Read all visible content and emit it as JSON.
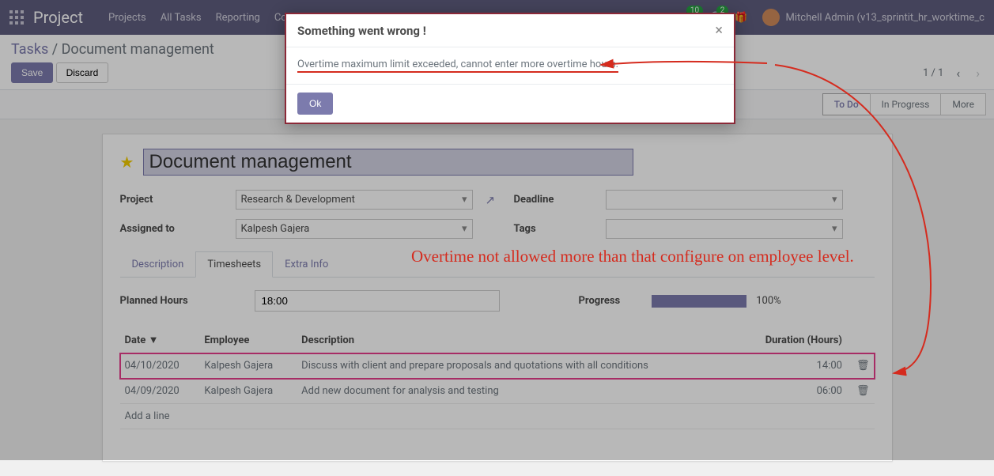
{
  "navbar": {
    "brand": "Project",
    "items": [
      "Projects",
      "All Tasks",
      "Reporting",
      "Configuration"
    ],
    "msg_badge": "10",
    "activity_badge": "2",
    "user_name": "Mitchell Admin (v13_sprintit_hr_worktime_c"
  },
  "breadcrumb": {
    "parent": "Tasks",
    "current": "Document management"
  },
  "buttons": {
    "save": "Save",
    "discard": "Discard"
  },
  "pager": {
    "text": "1 / 1"
  },
  "stages": {
    "s1": "To Do",
    "s2": "In Progress",
    "s3": "More"
  },
  "title": "Document management",
  "form": {
    "project_label": "Project",
    "project_value": "Research & Development",
    "assigned_label": "Assigned to",
    "assigned_value": "Kalpesh Gajera",
    "deadline_label": "Deadline",
    "tags_label": "Tags"
  },
  "tabs": {
    "t1": "Description",
    "t2": "Timesheets",
    "t3": "Extra Info"
  },
  "timesheet": {
    "planned_label": "Planned Hours",
    "planned_value": "18:00",
    "progress_label": "Progress",
    "progress_value": "100%",
    "headers": {
      "date": "Date",
      "employee": "Employee",
      "desc": "Description",
      "dur": "Duration (Hours)"
    },
    "rows": [
      {
        "date": "04/10/2020",
        "employee": "Kalpesh Gajera",
        "desc": "Discuss with client and prepare proposals and quotations with all conditions",
        "dur": "14:00"
      },
      {
        "date": "04/09/2020",
        "employee": "Kalpesh Gajera",
        "desc": "Add new document for analysis and testing",
        "dur": "06:00"
      }
    ],
    "add_line": "Add a line"
  },
  "modal": {
    "title": "Something went wrong !",
    "body": "Overtime maximum limit exceeded, cannot enter more overtime hours.",
    "ok": "Ok"
  },
  "annotation": "Overtime not allowed more than that configure on employee level."
}
